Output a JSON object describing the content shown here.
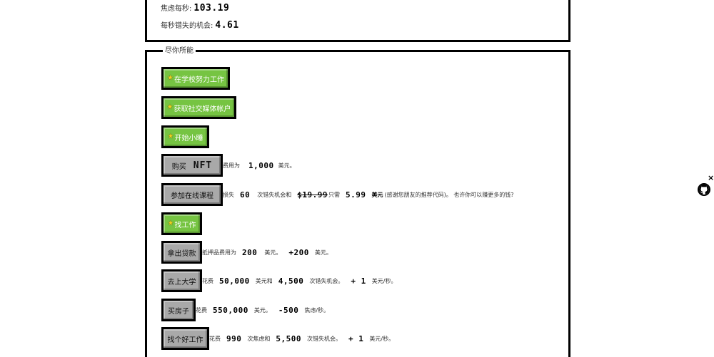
{
  "stats": {
    "anxiety_label": "焦虑每秒:",
    "anxiety_value": "103.19",
    "missed_label": "每秒错失的机会:",
    "missed_value": "4.61"
  },
  "actions": {
    "legend": "尽你所能",
    "work_school": "在学校努力工作",
    "social_account": "获取社交媒体帐户",
    "nap": "开始小睡",
    "nft": {
      "btn_prefix": "购买",
      "btn_suffix": "NFT",
      "d1": "费用为",
      "n1": "1,000",
      "d2": "美元。"
    },
    "course": {
      "btn": "参加在线课程",
      "d1": "损失",
      "n1": "60",
      "d2": "次错失机会和",
      "old_price": "$19.99",
      "d3": "只需",
      "n2": "5.99",
      "d4": "美元",
      "d5": "(感谢您朋友的推荐代码)。 也许你可以赚更多的钱?"
    },
    "find_job": "找工作",
    "loan": {
      "btn": "拿出贷款",
      "d1": "抵押品费用为",
      "n1": "200",
      "d2": "美元。",
      "n2": "+200",
      "d3": "美元。"
    },
    "college": {
      "btn": "去上大学",
      "d1": "花费",
      "n1": "50,000",
      "d2": "美元和",
      "n2": "4,500",
      "d3": "次错失机会。",
      "n3": "+ 1",
      "d4": "美元/秒。"
    },
    "house": {
      "btn": "买房子",
      "d1": "花费",
      "n1": "550,000",
      "d2": "美元。",
      "n2": "-500",
      "d3": "焦虑/秒。"
    },
    "good_job": {
      "btn": "找个好工作",
      "d1": "花费",
      "n1": "990",
      "d2": "次焦虑和",
      "n2": "5,500",
      "d3": "次错失机会。",
      "n3": "+ 1",
      "d4": "美元/秒。"
    }
  },
  "icons": {
    "star": "star-icon",
    "github": "github-icon",
    "close": "close-icon"
  },
  "colors": {
    "green_button": "#76c442",
    "gray_button": "#a9a9a9",
    "star": "#f0d020"
  },
  "close_glyph": "×"
}
